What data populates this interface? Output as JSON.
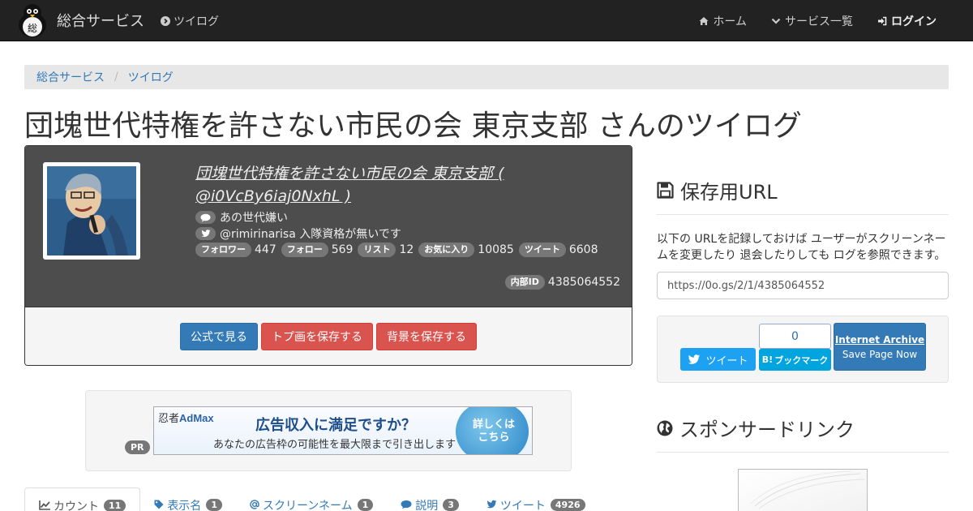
{
  "navbar": {
    "brand": "総合サービス",
    "logo_text": "総",
    "twilog": "ツイログ",
    "items": [
      {
        "label": "ホーム",
        "icon": "home-icon"
      },
      {
        "label": "サービス一覧",
        "icon": "chevron-down-icon"
      },
      {
        "label": "ログイン",
        "icon": "sign-in-icon"
      }
    ]
  },
  "breadcrumb": {
    "items": [
      "総合サービス",
      "ツイログ"
    ],
    "separator": "/"
  },
  "page_title": "団塊世代特権を許さない市民の会 東京支部 さんのツイログ",
  "profile": {
    "display_name": "団塊世代特権を許さない市民の会 東京支部 ( @i0VcBy6iaj0NxhL )",
    "bio": "あの世代嫌い",
    "twitter_line": "@rimirinarisa 入隊資格が無いです",
    "stats": [
      {
        "label": "フォロワー",
        "value": "447"
      },
      {
        "label": "フォロー",
        "value": "569"
      },
      {
        "label": "リスト",
        "value": "12"
      },
      {
        "label": "お気に入り",
        "value": "10085"
      },
      {
        "label": "ツイート",
        "value": "6608"
      }
    ],
    "internal_id_label": "内部ID",
    "internal_id": "4385064552",
    "buttons": {
      "official": "公式で見る",
      "save_avatar": "トプ画を保存する",
      "save_bg": "背景を保存する"
    }
  },
  "ad": {
    "pr": "PR",
    "logo_a": "忍者",
    "logo_b": "AdMax",
    "headline": "広告収入に満足ですか？",
    "sub": "あなたの広告枠の可能性を最大限まで引き出します",
    "cta_line1": "詳しくは",
    "cta_line2": "こちら"
  },
  "tabs": [
    {
      "label": "カウント",
      "count": "11",
      "icon": "line-chart-icon"
    },
    {
      "label": "表示名",
      "count": "1",
      "icon": "tag-icon"
    },
    {
      "label": "スクリーンネーム",
      "count": "1",
      "icon": "at-icon"
    },
    {
      "label": "説明",
      "count": "3",
      "icon": "comment-icon"
    },
    {
      "label": "ツイート",
      "count": "4926",
      "icon": "twitter-icon"
    }
  ],
  "save_url": {
    "title": "保存用URL",
    "description": "以下の URLを記録しておけば ユーザーがスクリーンネームを変更したり 退会したりしても ログを参照できます。",
    "url": "https://0o.gs/2/1/4385064552"
  },
  "share": {
    "tweet": "ツイート",
    "hatena_count": "0",
    "hatena_label": "ブックマーク",
    "hatena_mark": "B!",
    "ia_title": "Internet Archive",
    "ia_sub": "Save Page Now"
  },
  "sponsor": {
    "title": "スポンサードリンク"
  },
  "colors": {
    "navbar": "#222222",
    "primary": "#337ab7",
    "danger": "#d9534f",
    "badge": "#777777",
    "twitter": "#1da1f2",
    "hatena": "#00a4de"
  }
}
